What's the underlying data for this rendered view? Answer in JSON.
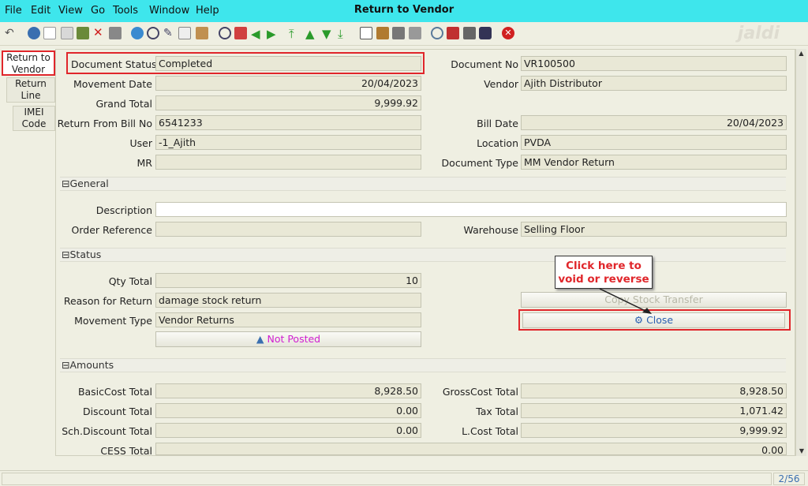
{
  "menu": {
    "items": [
      "File",
      "Edit",
      "View",
      "Go",
      "Tools",
      "Window",
      "Help"
    ],
    "title": "Return to Vendor"
  },
  "logo": "jaldi",
  "tabs": [
    "Return to Vendor",
    "Return Line",
    "IMEI Code"
  ],
  "fields": {
    "doc_status": {
      "label": "Document Status",
      "value": "Completed"
    },
    "doc_no": {
      "label": "Document No",
      "value": "VR100500"
    },
    "movement_date": {
      "label": "Movement Date",
      "value": "20/04/2023"
    },
    "vendor": {
      "label": "Vendor",
      "value": "Ajith Distributor"
    },
    "grand_total": {
      "label": "Grand Total",
      "value": "9,999.92"
    },
    "return_bill_no": {
      "label": "Return From Bill No",
      "value": "6541233"
    },
    "bill_date": {
      "label": "Bill Date",
      "value": "20/04/2023"
    },
    "user": {
      "label": "User",
      "value": "-1_Ajith"
    },
    "location": {
      "label": "Location",
      "value": "PVDA"
    },
    "mr": {
      "label": "MR",
      "value": ""
    },
    "doc_type": {
      "label": "Document Type",
      "value": "MM Vendor Return"
    },
    "description": {
      "label": "Description",
      "value": ""
    },
    "order_ref": {
      "label": "Order Reference",
      "value": ""
    },
    "warehouse": {
      "label": "Warehouse",
      "value": "Selling Floor"
    },
    "qty_total": {
      "label": "Qty Total",
      "value": "10"
    },
    "reason": {
      "label": "Reason for Return",
      "value": "damage stock return"
    },
    "movement_type": {
      "label": "Movement Type",
      "value": "Vendor Returns"
    },
    "basic_cost": {
      "label": "BasicCost Total",
      "value": "8,928.50"
    },
    "gross_cost": {
      "label": "GrossCost Total",
      "value": "8,928.50"
    },
    "discount": {
      "label": "Discount Total",
      "value": "0.00"
    },
    "tax": {
      "label": "Tax Total",
      "value": "1,071.42"
    },
    "sch_discount": {
      "label": "Sch.Discount Total",
      "value": "0.00"
    },
    "lcost": {
      "label": "L.Cost Total",
      "value": "9,999.92"
    },
    "cess": {
      "label": "CESS Total",
      "value": "0.00"
    }
  },
  "sections": {
    "general": "General",
    "status": "Status",
    "amounts": "Amounts"
  },
  "buttons": {
    "not_posted": "Not Posted",
    "copy_stock": "Copy Stock Transfer",
    "close": "Close"
  },
  "callout": "Click here to void or reverse",
  "status": {
    "record": "2/56"
  },
  "colors": {
    "menubar": "#3ee6ec",
    "highlight": "#e0262b",
    "not_posted": "#d020d0"
  }
}
